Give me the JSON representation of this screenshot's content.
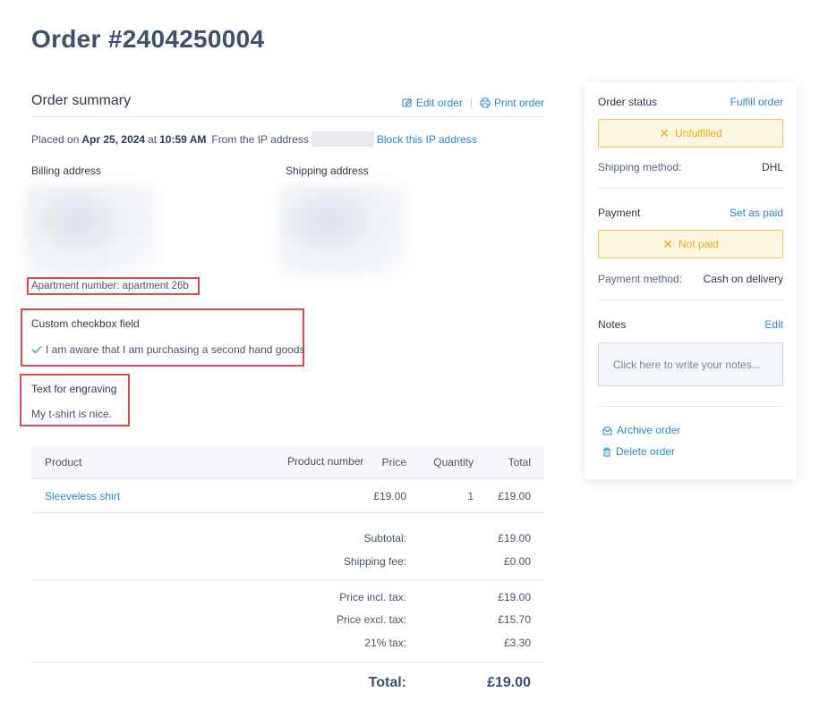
{
  "page": {
    "title": "Order #2404250004"
  },
  "summary": {
    "title": "Order summary",
    "edit_label": "Edit order",
    "print_label": "Print order",
    "separator": "|",
    "placed_prefix": "Placed on",
    "placed_date": "Apr 25, 2024",
    "placed_at": "at",
    "placed_time": "10:59 AM",
    "ip_prefix": "From the IP address",
    "block_ip_label": "Block this IP address"
  },
  "billing": {
    "label": "Billing address"
  },
  "shipping": {
    "label": "Shipping address"
  },
  "apartment": {
    "text": "Apartment number: apartment 26b"
  },
  "custom_checkbox": {
    "title": "Custom checkbox field",
    "value": "I am aware that I am purchasing a second hand goods"
  },
  "engraving": {
    "title": "Text for engraving",
    "value": "My t-shirt is nice."
  },
  "table": {
    "headers": [
      "Product",
      "Product number",
      "Price",
      "Quantity",
      "Total"
    ],
    "rows": [
      {
        "product": "Sleeveless shirt",
        "product_number": "",
        "price": "£19.00",
        "quantity": "1",
        "total": "£19.00"
      }
    ]
  },
  "totals": {
    "subtotal_label": "Subtotal:",
    "subtotal": "£19.00",
    "shipping_label": "Shipping fee:",
    "shipping": "£0.00",
    "incl_label": "Price incl. tax:",
    "incl": "£19.00",
    "excl_label": "Price excl. tax:",
    "excl": "£15.70",
    "tax_label": "21% tax:",
    "tax": "£3.30",
    "total_label": "Total:",
    "total": "£19.00"
  },
  "sidebar": {
    "status_title": "Order status",
    "fulfill_label": "Fulfill order",
    "status_value": "Unfulfilled",
    "shipping_method_label": "Shipping method:",
    "shipping_method": "DHL",
    "payment_title": "Payment",
    "set_paid_label": "Set as paid",
    "payment_value": "Not paid",
    "payment_method_label": "Payment method:",
    "payment_method": "Cash on delivery",
    "notes_title": "Notes",
    "notes_edit": "Edit",
    "notes_placeholder": "Click here to write your notes...",
    "archive_label": "Archive order",
    "delete_label": "Delete order"
  },
  "colors": {
    "link": "#2b8ac9",
    "warning_bg": "#fff8e1",
    "warning_border": "#f4c24e",
    "warning_text": "#f2a71b",
    "highlight_border": "#e04848",
    "check": "#3cb371"
  }
}
